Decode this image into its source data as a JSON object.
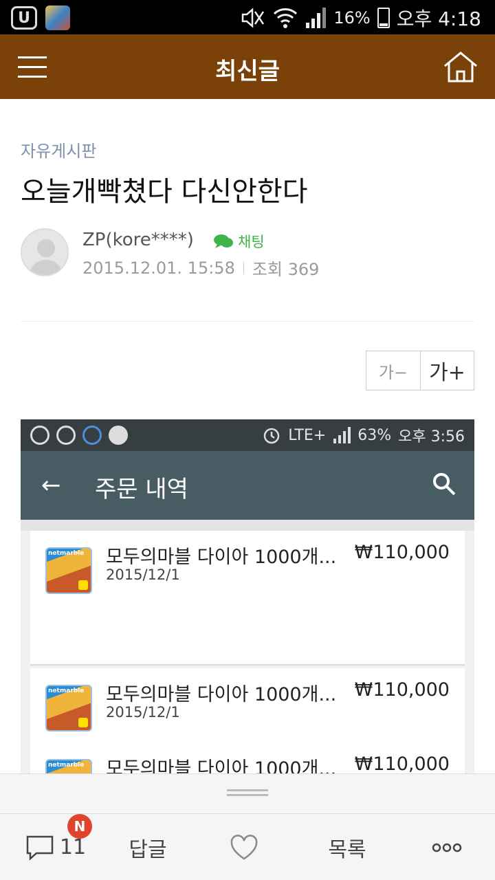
{
  "status_bar": {
    "battery": "16%",
    "time": "오후 4:18"
  },
  "app_bar": {
    "title": "최신글"
  },
  "post": {
    "category": "자유게시판",
    "title": "오늘개빡쳤다 다신안한다",
    "author": "ZP(kore****)",
    "chat_label": "채팅",
    "date": "2015.12.01. 15:58",
    "views": "조회 369"
  },
  "font_controls": {
    "smaller": "가−",
    "larger": "가+"
  },
  "embed": {
    "status": {
      "network": "LTE+",
      "battery": "63%",
      "time": "오후 3:56"
    },
    "title": "주문 내역",
    "orders": [
      {
        "name": "모두의마블 다이아 1000개...",
        "date": "2015/12/1",
        "price": "₩110,000"
      },
      {
        "name": "모두의마블 다이아 1000개...",
        "date": "2015/12/1",
        "price": "₩110,000"
      },
      {
        "name": "모두의마블 다이아 1000개...",
        "date": "",
        "price": "₩110,000"
      }
    ]
  },
  "bottom_bar": {
    "comment_count": "11",
    "new_badge": "N",
    "reply_label": "답글",
    "list_label": "목록"
  }
}
